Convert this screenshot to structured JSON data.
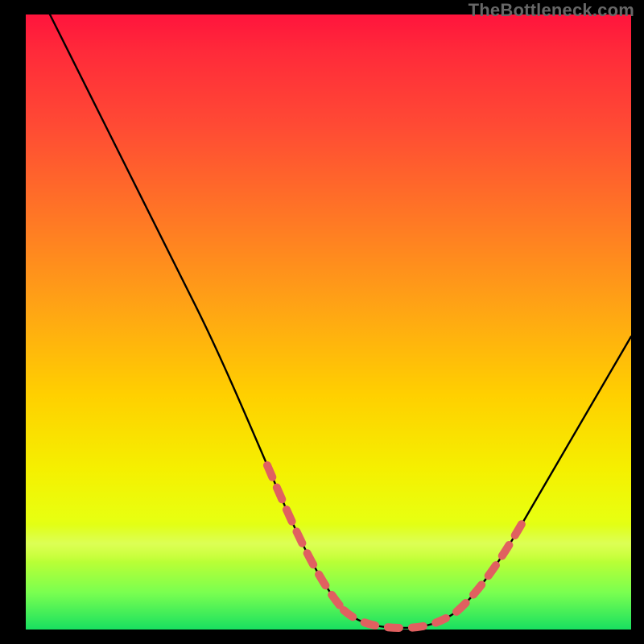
{
  "watermark": "TheBottleneck.com",
  "colors": {
    "frame": "#000000",
    "curve": "#000000",
    "dash": "#e06060",
    "grad_top": "#ff143c",
    "grad_mid1": "#ff7a24",
    "grad_mid2": "#ffd000",
    "grad_mid3": "#e8ff10",
    "grad_bottom": "#18e060"
  },
  "chart_data": {
    "type": "line",
    "title": "",
    "xlabel": "",
    "ylabel": "",
    "xlim": [
      0,
      100
    ],
    "ylim": [
      0,
      100
    ],
    "note": "Values are read off in percent of plot width (x) and height above bottom (y). Curve descends steeply from top-left to a flat minimum around x≈55–65, then rises toward the right edge. Dashed salmon segments overlay the curve near the minimum on both sides.",
    "series": [
      {
        "name": "bottleneck-curve",
        "x": [
          4,
          8,
          12,
          16,
          20,
          24,
          28,
          32,
          36,
          40,
          44,
          48,
          52,
          56,
          60,
          64,
          68,
          72,
          76,
          80,
          84,
          88,
          92,
          96,
          100
        ],
        "y": [
          100,
          94,
          88,
          82,
          75,
          67,
          59,
          50,
          41,
          32,
          23,
          15,
          8,
          3,
          1,
          1,
          3,
          7,
          13,
          20,
          27,
          34,
          41,
          47,
          52
        ]
      }
    ],
    "dash_segments_x_ranges": [
      {
        "side": "left",
        "x_from": 40,
        "x_to": 53
      },
      {
        "side": "floor",
        "x_from": 53,
        "x_to": 67
      },
      {
        "side": "right",
        "x_from": 67,
        "x_to": 78
      }
    ]
  }
}
